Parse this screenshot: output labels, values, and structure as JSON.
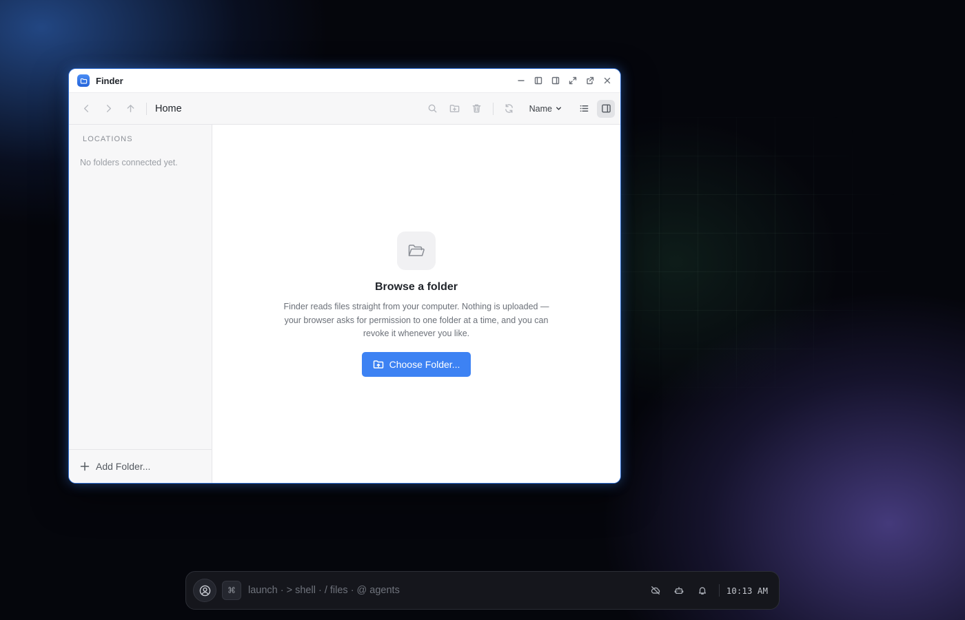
{
  "window": {
    "title": "Finder",
    "app_icon": "folder-icon"
  },
  "toolbar": {
    "breadcrumb": "Home",
    "sort_label": "Name"
  },
  "sidebar": {
    "section_header": "LOCATIONS",
    "empty_text": "No folders connected yet.",
    "add_folder_label": "Add Folder..."
  },
  "main": {
    "empty_title": "Browse a folder",
    "empty_description": "Finder reads files straight from your computer. Nothing is uploaded — your browser asks for permission to one folder at a time, and you can revoke it whenever you like.",
    "choose_button_label": "Choose Folder..."
  },
  "taskbar": {
    "command_key": "⌘",
    "prompt": "launch · > shell · / files · @ agents",
    "clock": "10:13 AM"
  },
  "colors": {
    "accent": "#3d82f3",
    "window_border": "#2f6fd6"
  }
}
